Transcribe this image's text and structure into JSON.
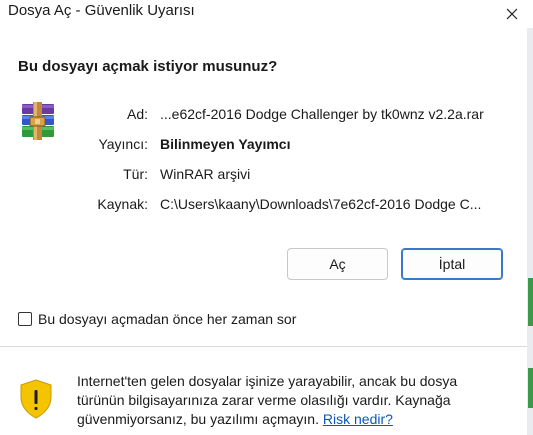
{
  "window": {
    "title": "Dosya Aç - Güvenlik Uyarısı",
    "close_icon": "close-icon"
  },
  "question": "Bu dosyayı açmak istiyor musunuz?",
  "file_icon": "winrar-archive-icon",
  "fields": {
    "name_label": "Ad:",
    "name_value": "...e62cf-2016 Dodge Challenger by tk0wnz v2.2a.rar",
    "publisher_label": "Yayıncı:",
    "publisher_value": "Bilinmeyen Yayımcı",
    "type_label": "Tür:",
    "type_value": "WinRAR arşivi",
    "source_label": "Kaynak:",
    "source_value": "C:\\Users\\kaany\\Downloads\\7e62cf-2016 Dodge C..."
  },
  "buttons": {
    "open": "Aç",
    "cancel": "İptal"
  },
  "checkbox": {
    "label": "Bu dosyayı açmadan önce her zaman sor",
    "checked": false
  },
  "warning": {
    "icon": "shield-warning-icon",
    "text": "Internet'ten gelen dosyalar işinize yarayabilir, ancak bu dosya türünün bilgisayarınıza zarar verme olasılığı vardır. Kaynağa güvenmiyorsanız, bu yazılımı açmayın.",
    "link": "Risk nedir?"
  },
  "colors": {
    "primary_border": "#3a78c9",
    "link": "#0b57b7",
    "shield": "#f5c400"
  }
}
